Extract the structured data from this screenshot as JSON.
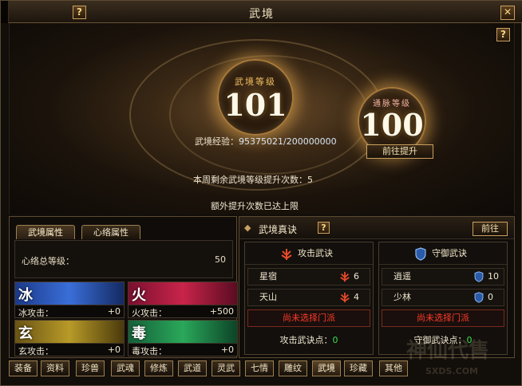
{
  "window": {
    "title": "武境"
  },
  "hero": {
    "level_label": "武境等级",
    "level_value": "101",
    "meridian_label": "通脉等级",
    "meridian_value": "100",
    "exp_label": "武境经验：",
    "exp_value": "95375021/200000000",
    "goto_button": "前往提升",
    "weekly_label": "本周剩余武境等级提升次数：",
    "weekly_value": "5",
    "extra_limit": "额外提升次数已达上限"
  },
  "left": {
    "tabs": [
      "武境属性",
      "心络属性"
    ],
    "total_label": "心络总等级：",
    "total_value": "50",
    "stats": [
      {
        "glyph": "冰",
        "label": "冰攻击：",
        "value": "+0",
        "color": "#3a6ed8"
      },
      {
        "glyph": "火",
        "label": "火攻击：",
        "value": "+500",
        "color": "#c8244a"
      },
      {
        "glyph": "玄",
        "label": "玄攻击：",
        "value": "+0",
        "color": "#b89a28"
      },
      {
        "glyph": "毒",
        "label": "毒攻击：",
        "value": "+0",
        "color": "#2aa85a"
      }
    ]
  },
  "right": {
    "title": "武境真诀",
    "goto_button": "前往",
    "attack": {
      "header": "攻击武诀",
      "skills": [
        {
          "name": "星宿",
          "count": "6"
        },
        {
          "name": "天山",
          "count": "4"
        }
      ],
      "unselected": "尚未选择门派",
      "points_label": "攻击武诀点：",
      "points_value": "0"
    },
    "defense": {
      "header": "守御武诀",
      "skills": [
        {
          "name": "逍遥",
          "count": "10"
        },
        {
          "name": "少林",
          "count": "0"
        }
      ],
      "unselected": "尚未选择门派",
      "points_label": "守御武诀点：",
      "points_value": "0"
    }
  },
  "bottom_tabs": [
    "装备",
    "资料",
    "珍兽",
    "武魂",
    "修炼",
    "武道",
    "灵武",
    "七情",
    "雕纹",
    "武境",
    "珍藏",
    "其他"
  ],
  "active_bottom_tab": "武境",
  "watermark": {
    "brand": "神仙代售",
    "url": "SXDS.COM"
  },
  "colors": {
    "gold": "#c8a060",
    "red_text": "#ff3a2a",
    "green_points": "#39e04a"
  }
}
